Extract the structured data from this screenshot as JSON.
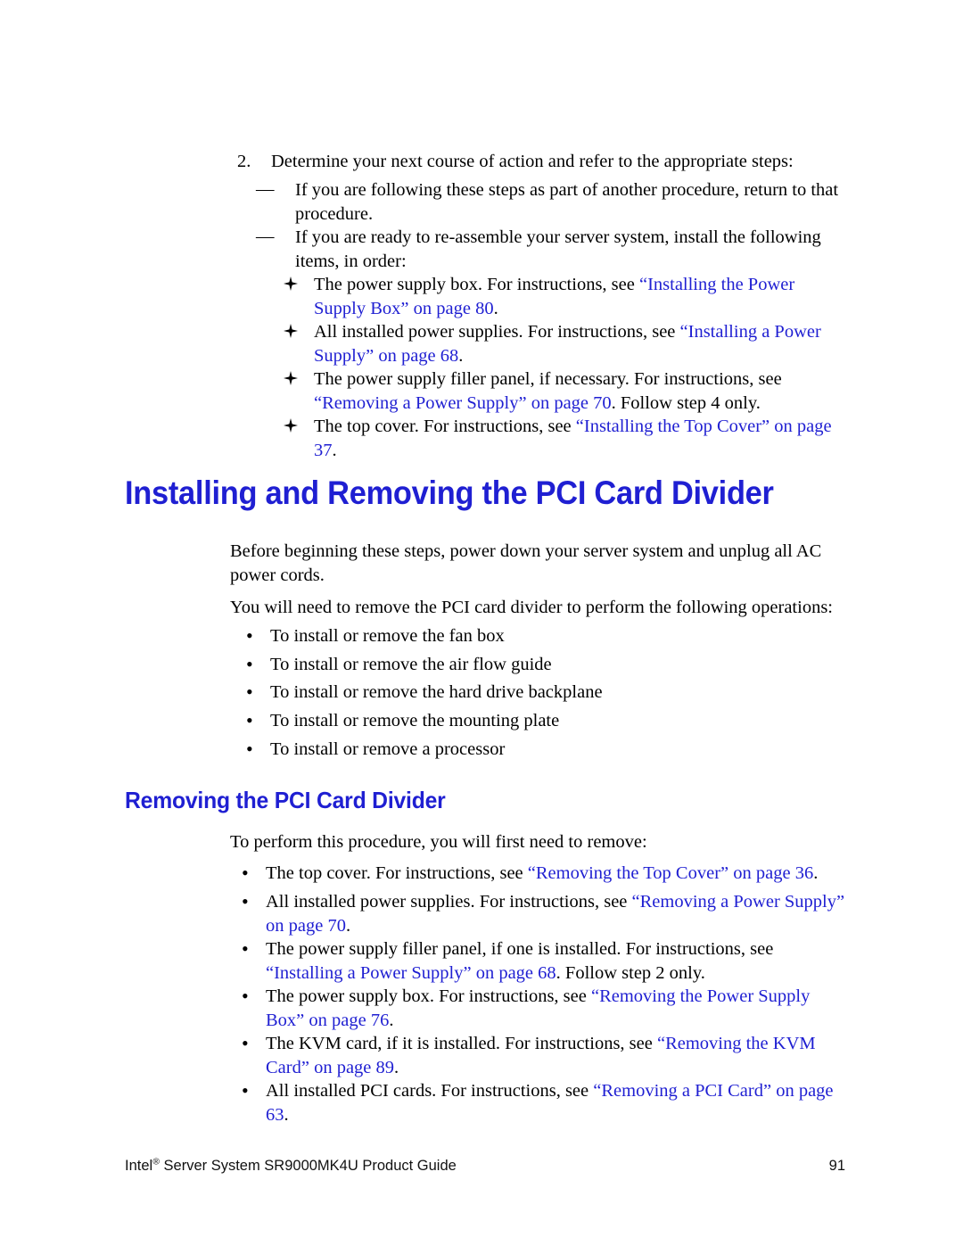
{
  "document": {
    "title": "Intel Server System SR9000MK4U Product Guide",
    "page_number": "91",
    "link_color": "#1f1fd2",
    "text_color": "#000000"
  },
  "step2": {
    "number": "2.",
    "text": "Determine your next course of action and refer to the appropriate steps:"
  },
  "dash_items": [
    {
      "marker": "—",
      "text": "If you are following these steps as part of another procedure, return to that procedure."
    },
    {
      "marker": "—",
      "text": "If you are ready to re-assemble your server system, install the following items, in order:"
    }
  ],
  "diamond_items": [
    {
      "lead": "The power supply box. For instructions, see ",
      "link": "“Installing the Power Supply Box” on page 80",
      "tail": "."
    },
    {
      "lead": "All installed power supplies. For instructions, see ",
      "link": "“Installing a Power Supply” on page 68",
      "tail": "."
    },
    {
      "lead": "The power supply filler panel, if necessary. For instructions, see ",
      "link": "“Removing a Power Supply” on page 70",
      "tail": ". Follow step 4 only."
    },
    {
      "lead": "The top cover. For instructions, see ",
      "link": "“Installing the Top Cover” on page 37",
      "tail": "."
    }
  ],
  "heading1": "Installing and Removing the PCI Card Divider",
  "intro_paragraph_1": "Before beginning these steps, power down your server system and unplug all AC power cords.",
  "intro_paragraph_2": "You will need to remove the PCI card divider to perform the following operations:",
  "operations": [
    {
      "marker": "•",
      "text": "To install or remove the fan box"
    },
    {
      "marker": "•",
      "text": "To install or remove the air flow guide"
    },
    {
      "marker": "•",
      "text": "To install or remove the hard drive backplane"
    },
    {
      "marker": "•",
      "text": "To install or remove the mounting plate"
    },
    {
      "marker": "•",
      "text": "To install or remove a processor"
    }
  ],
  "heading2": "Removing the PCI Card Divider",
  "removal_intro": "To perform this procedure, you will first need to remove:",
  "removal_items": [
    {
      "marker": "•",
      "lead": "The top cover. For instructions, see ",
      "link": "“Removing the Top Cover” on page 36",
      "tail": "."
    },
    {
      "marker": "•",
      "lead": "All installed power supplies. For instructions, see ",
      "link": "“Removing a Power Supply” on page 70",
      "tail": "."
    },
    {
      "marker": "•",
      "lead": "The power supply filler panel, if one is installed. For instructions, see ",
      "link": "“Installing a Power Supply” on page 68",
      "tail": ". Follow step 2 only."
    },
    {
      "marker": "•",
      "lead": "The power supply box. For instructions, see ",
      "link": "“Removing the Power Supply Box” on page 76",
      "tail": "."
    },
    {
      "marker": "•",
      "lead": "The KVM card, if it is installed. For instructions, see ",
      "link": "“Removing the KVM Card” on page 89",
      "tail": "."
    },
    {
      "marker": "•",
      "lead": "All installed PCI cards. For instructions, see ",
      "link": "“Removing a PCI Card” on page 63",
      "tail": "."
    }
  ],
  "footer": {
    "company": "Intel",
    "registered_mark": "®",
    "product": " Server System SR9000MK4U Product Guide",
    "page": "91"
  }
}
